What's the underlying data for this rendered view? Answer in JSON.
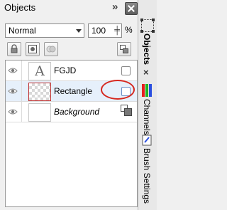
{
  "panel": {
    "title": "Objects",
    "blend_mode": "Normal",
    "opacity_value": "100",
    "opacity_unit": "%",
    "layers": [
      {
        "name": "FGJD",
        "type": "text",
        "selected": false,
        "style": "normal"
      },
      {
        "name": "Rectangle",
        "type": "rectangle",
        "selected": true,
        "style": "normal"
      },
      {
        "name": "Background",
        "type": "background",
        "selected": false,
        "style": "italic"
      }
    ]
  },
  "sidebar": {
    "tabs": [
      "Objects",
      "Channels",
      "Brush Settings"
    ]
  },
  "colors": {
    "selection": "#e6f0fb",
    "highlight_circle": "#d6281f"
  }
}
